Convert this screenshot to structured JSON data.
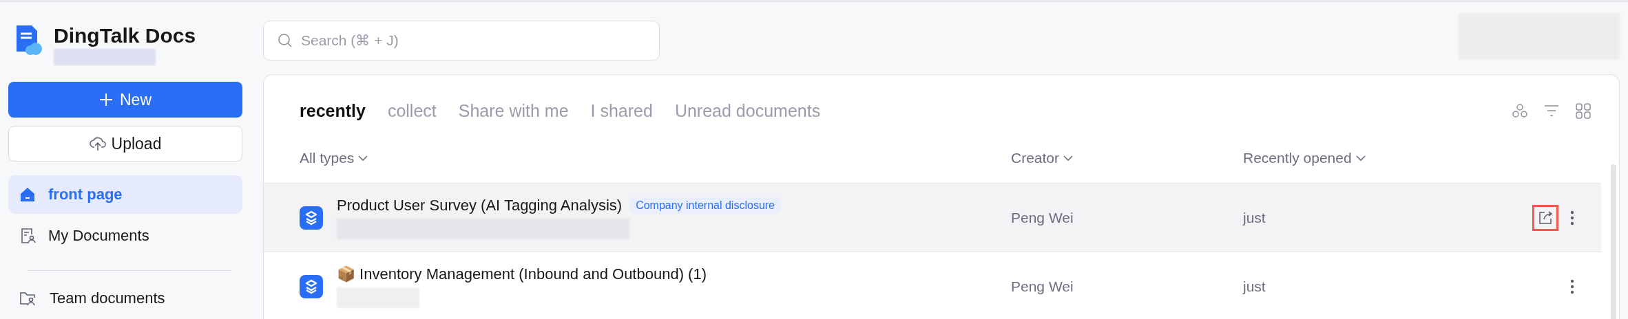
{
  "app": {
    "title": "DingTalk Docs"
  },
  "sidebar": {
    "new_button": "New",
    "upload_button": "Upload",
    "items": [
      {
        "label": "front page",
        "selected": true
      },
      {
        "label": "My Documents",
        "selected": false
      },
      {
        "label": "Team documents",
        "selected": false
      }
    ]
  },
  "search": {
    "placeholder": "Search (⌘ + J)"
  },
  "tabs": [
    {
      "label": "recently",
      "selected": true
    },
    {
      "label": "collect",
      "selected": false
    },
    {
      "label": "Share with me",
      "selected": false
    },
    {
      "label": "I shared",
      "selected": false
    },
    {
      "label": "Unread documents",
      "selected": false
    }
  ],
  "table": {
    "columns": [
      "All types",
      "Creator",
      "Recently opened"
    ],
    "rows": [
      {
        "title": "Product User Survey (AI Tagging Analysis)",
        "badge": "Company internal disclosure",
        "creator": "Peng Wei",
        "opened": "just",
        "hovered": true,
        "share_button": {
          "outlined": true
        }
      },
      {
        "title": "📦 Inventory Management (Inbound and Outbound) (1)",
        "creator": "Peng Wei",
        "opened": "just",
        "hovered": false
      }
    ]
  }
}
